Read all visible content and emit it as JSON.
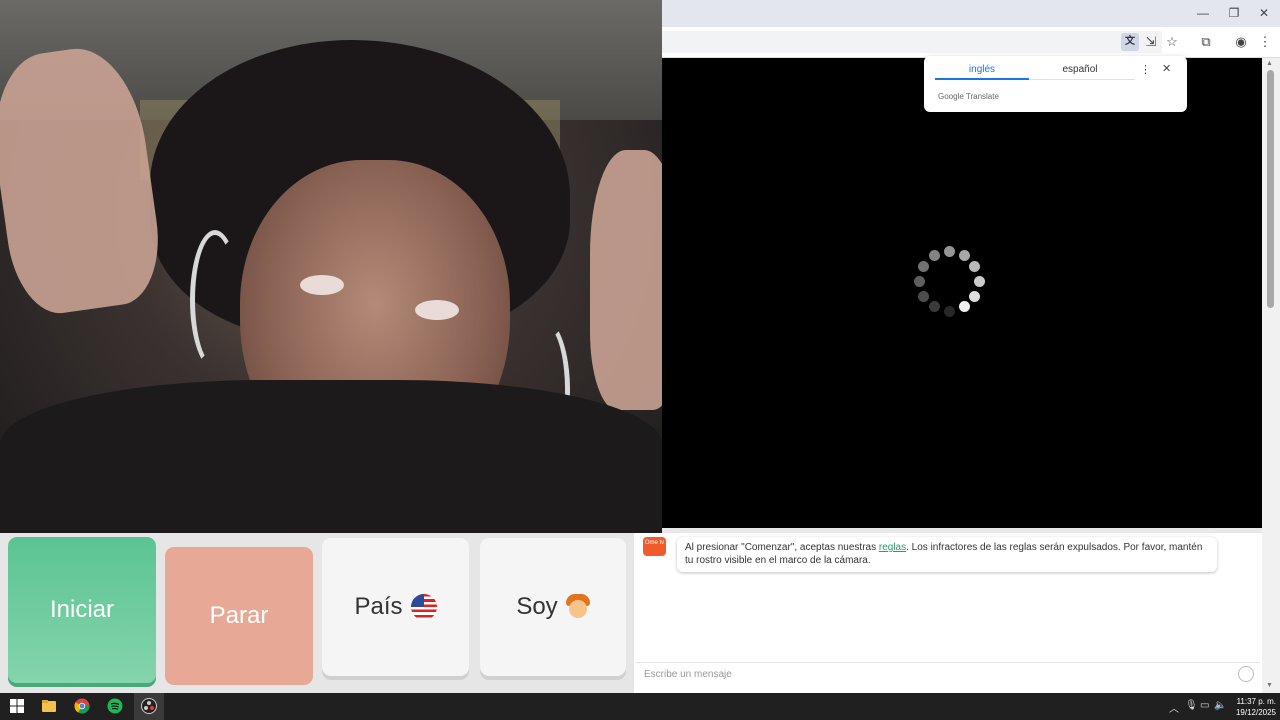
{
  "browser": {
    "window_controls": {
      "minimize": "—",
      "restore": "❐",
      "close": "✕"
    },
    "toolbar_icons": {
      "translate": "translate-icon",
      "install": "install-app-icon",
      "bookmark": "star-icon",
      "extensions": "puzzle-icon",
      "profile": "profile-icon",
      "menu": "kebab-menu-icon"
    },
    "translate_popup": {
      "tab_source": "inglés",
      "tab_target": "español",
      "brand": "Google Translate",
      "menu_glyph": "⋮",
      "close_glyph": "✕"
    }
  },
  "controls": {
    "start_label": "Iniciar",
    "stop_label": "Parar",
    "country_label": "País",
    "country_flag": "us-flag-icon",
    "iam_label": "Soy",
    "iam_icon": "redhead-person-icon",
    "colors": {
      "start": "#5bc493",
      "stop": "#e7a896",
      "neutral": "#f5f5f5"
    }
  },
  "chat": {
    "logo_text": "Ome tv",
    "system_message": {
      "before_link": "Al presionar \"Comenzar\", aceptas nuestras ",
      "link": "reglas",
      "after_link": ". Los infractores de las reglas serán expulsados. Por favor, mantén tu rostro visible en el marco de la cámara."
    },
    "input_placeholder": "Escribe un mensaje"
  },
  "taskbar": {
    "time": "11:37 p. m.",
    "date": "19/12/2025"
  }
}
